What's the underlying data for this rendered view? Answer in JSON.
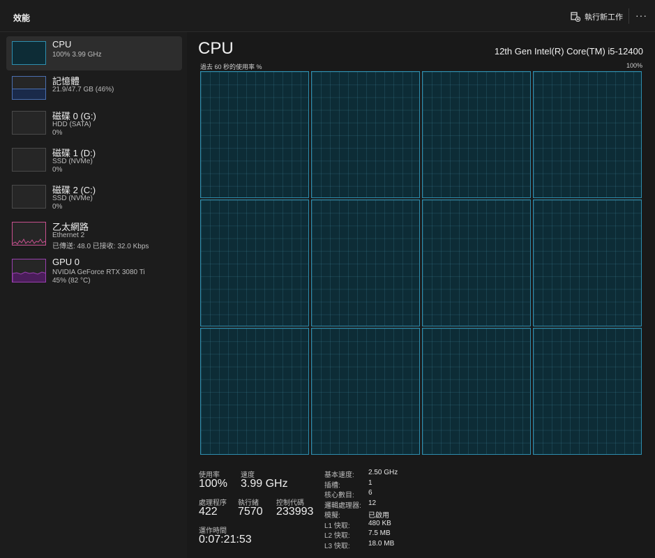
{
  "header": {
    "title": "效能",
    "new_task_label": "執行新工作",
    "more_label": "···"
  },
  "sidebar": {
    "items": [
      {
        "name": "CPU",
        "line1": "100%  3.99 GHz",
        "line2": ""
      },
      {
        "name": "記憶體",
        "line1": "21.9/47.7 GB (46%)",
        "line2": ""
      },
      {
        "name": "磁碟 0 (G:)",
        "line1": "HDD (SATA)",
        "line2": "0%"
      },
      {
        "name": "磁碟 1 (D:)",
        "line1": "SSD (NVMe)",
        "line2": "0%"
      },
      {
        "name": "磁碟 2 (C:)",
        "line1": "SSD (NVMe)",
        "line2": "0%"
      },
      {
        "name": "乙太網路",
        "line1": "Ethernet 2",
        "line2": "已傳送: 48.0  已接收: 32.0 Kbps"
      },
      {
        "name": "GPU 0",
        "line1": "NVIDIA GeForce RTX 3080 Ti",
        "line2": "45%  (82 °C)"
      }
    ],
    "memory_fill": 0.46,
    "colors": {
      "cpu": "#2e8fb0",
      "memory": "#4a6fb0",
      "network": "#c8508f",
      "gpu": "#9a3fb0"
    }
  },
  "main": {
    "title": "CPU",
    "model": "12th Gen Intel(R) Core(TM) i5-12400",
    "graph_label": "過去 60 秒的使用率 %",
    "graph_max": "100%",
    "core_count": 12,
    "core_usage": 1.0,
    "stats": {
      "utilization_label": "使用率",
      "utilization_value": "100%",
      "speed_label": "速度",
      "speed_value": "3.99 GHz",
      "processes_label": "處理程序",
      "processes_value": "422",
      "threads_label": "執行緒",
      "threads_value": "7570",
      "handles_label": "控制代碼",
      "handles_value": "233993",
      "uptime_label": "運作時間",
      "uptime_value": "0:07:21:53"
    },
    "specs": [
      {
        "key": "基本速度:",
        "value": "2.50 GHz"
      },
      {
        "key": "插槽:",
        "value": "1"
      },
      {
        "key": "核心數目:",
        "value": "6"
      },
      {
        "key": "邏輯處理器:",
        "value": "12"
      },
      {
        "key": "模擬:",
        "value": "已啟用"
      },
      {
        "key": "L1 快取:",
        "value": "480 KB"
      },
      {
        "key": "L2 快取:",
        "value": "7.5 MB"
      },
      {
        "key": "L3 快取:",
        "value": "18.0 MB"
      }
    ]
  }
}
